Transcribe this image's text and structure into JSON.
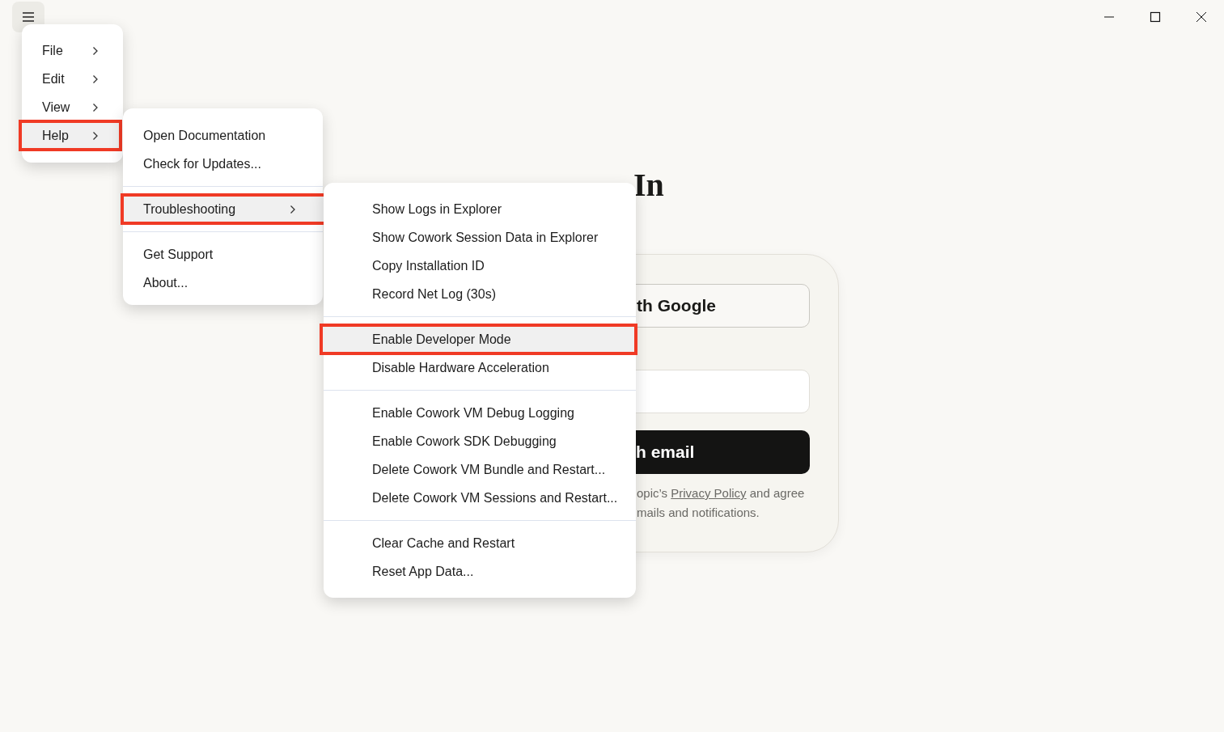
{
  "heading": "In",
  "card": {
    "google_button": "th Google",
    "email_button": "h email",
    "legal": {
      "before": "opic’s",
      "link": "Privacy Policy",
      "after": "and agree",
      "line_2": "mails and notifications."
    }
  },
  "menus": [
    {
      "groups": [
        [
          {
            "label": "File",
            "submenu": true,
            "selected": false
          },
          {
            "label": "Edit",
            "submenu": true,
            "selected": false
          },
          {
            "label": "View",
            "submenu": true,
            "selected": false
          },
          {
            "label": "Help",
            "submenu": true,
            "selected": true
          }
        ]
      ]
    },
    {
      "groups": [
        [
          {
            "label": "Open Documentation",
            "submenu": false,
            "selected": false
          },
          {
            "label": "Check for Updates...",
            "submenu": false,
            "selected": false
          }
        ],
        [
          {
            "label": "Troubleshooting",
            "submenu": true,
            "selected": true
          }
        ],
        [
          {
            "label": "Get Support",
            "submenu": false,
            "selected": false
          },
          {
            "label": "About...",
            "submenu": false,
            "selected": false
          }
        ]
      ]
    },
    {
      "groups": [
        [
          {
            "label": "Show Logs in Explorer",
            "submenu": false,
            "selected": false
          },
          {
            "label": "Show Cowork Session Data in Explorer",
            "submenu": false,
            "selected": false
          },
          {
            "label": "Copy Installation ID",
            "submenu": false,
            "selected": false
          },
          {
            "label": "Record Net Log (30s)",
            "submenu": false,
            "selected": false
          }
        ],
        [
          {
            "label": "Enable Developer Mode",
            "submenu": false,
            "selected": true
          },
          {
            "label": "Disable Hardware Acceleration",
            "submenu": false,
            "selected": false
          }
        ],
        [
          {
            "label": "Enable Cowork VM Debug Logging",
            "submenu": false,
            "selected": false
          },
          {
            "label": "Enable Cowork SDK Debugging",
            "submenu": false,
            "selected": false
          },
          {
            "label": "Delete Cowork VM Bundle and Restart...",
            "submenu": false,
            "selected": false
          },
          {
            "label": "Delete Cowork VM Sessions and Restart...",
            "submenu": false,
            "selected": false
          }
        ],
        [
          {
            "label": "Clear Cache and Restart",
            "submenu": false,
            "selected": false
          },
          {
            "label": "Reset App Data...",
            "submenu": false,
            "selected": false
          }
        ]
      ]
    }
  ]
}
